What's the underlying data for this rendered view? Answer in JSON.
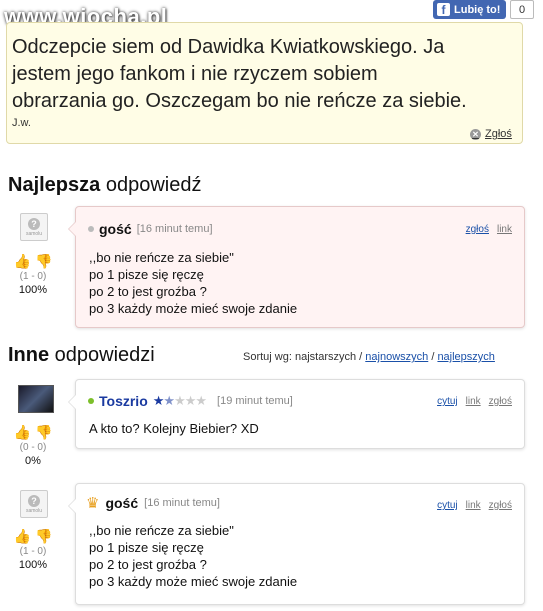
{
  "header": {
    "logo": "www.wiocha.pl",
    "like_label": "Lubię to!",
    "like_count": "0"
  },
  "quote": {
    "lines": [
      "Odczepcie siem od Dawidka Kwiatkowskiego. Ja",
      "jestem jego fankom i nie rzyczem sobiem",
      "obrarzania go. Oszczegam bo nie reńcze za siebie."
    ],
    "author": "J.w.",
    "report_label": "Zgłoś"
  },
  "best": {
    "heading_bold": "Najlepsza",
    "heading_rest": " odpowiedź",
    "answer": {
      "author": "gość",
      "time": "[16 minut temu]",
      "actions": [
        "zgłoś",
        "link"
      ],
      "lines": [
        ",,bo nie reńcze za siebie\"",
        "po 1 pisze się ręczę",
        "po 2 to jest groźba ?",
        "po 3 każdy może mieć swoje zdanie"
      ],
      "votes": "(1 - 0)",
      "percent": "100%"
    }
  },
  "others": {
    "heading_bold": "Inne",
    "heading_rest": " odpowiedzi",
    "sort_prefix": "Sortuj wg: najstarszych / ",
    "sort_newest": "najnowszych",
    "sort_sep": " / ",
    "sort_best": "najlepszych",
    "answers": [
      {
        "author": "Toszrio",
        "time": "[19 minut temu]",
        "actions": [
          "cytuj",
          "link",
          "zgłoś"
        ],
        "lines": [
          "A kto to? Kolejny Biebier? XD"
        ],
        "votes": "(0 - 0)",
        "percent": "0%",
        "rating_stars": 1.5,
        "status_color": "#7cbf2a"
      },
      {
        "author": "gość",
        "time": "[16 minut temu]",
        "actions": [
          "cytuj",
          "link",
          "zgłoś"
        ],
        "lines": [
          ",,bo nie reńcze za siebie\"",
          "po 1 pisze się ręczę",
          "po 2 to jest groźba ?",
          "po 3 każdy może mieć swoje zdanie"
        ],
        "votes": "(1 - 0)",
        "percent": "100%"
      }
    ]
  },
  "anon_avatar_text": "samolu"
}
